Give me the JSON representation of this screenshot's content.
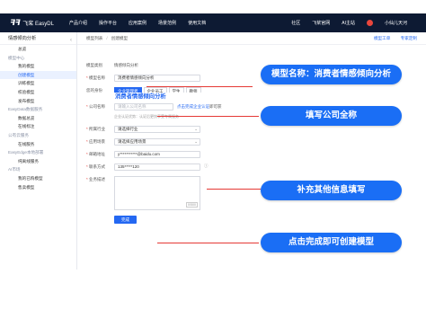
{
  "topnav": {
    "logo_text": "飞桨 EasyDL",
    "left_items": [
      "产品介绍",
      "操作平台",
      "应用案例",
      "场景范例",
      "使用文档"
    ],
    "right_items": [
      "社区",
      "飞桨官网",
      "AI主站"
    ],
    "user_name": "小仙儿天河"
  },
  "sidebar": {
    "title": "情感倾向分析",
    "items": [
      {
        "label": "总览",
        "kind": "item"
      },
      {
        "label": "模型中心",
        "kind": "group"
      },
      {
        "label": "我的模型",
        "kind": "item"
      },
      {
        "label": "创建模型",
        "kind": "item",
        "active": true
      },
      {
        "label": "训练模型",
        "kind": "item"
      },
      {
        "label": "校验模型",
        "kind": "item"
      },
      {
        "label": "发布模型",
        "kind": "item"
      },
      {
        "label": "EasyData数据服务",
        "kind": "group"
      },
      {
        "label": "数据总览",
        "kind": "item"
      },
      {
        "label": "在线标注",
        "kind": "item"
      },
      {
        "label": "公有云服务",
        "kind": "group"
      },
      {
        "label": "在线服务",
        "kind": "item"
      },
      {
        "label": "EasyEdge本地部署",
        "kind": "group"
      },
      {
        "label": "纯离线服务",
        "kind": "item"
      },
      {
        "label": "AI市场",
        "kind": "group"
      },
      {
        "label": "我的已购模型",
        "kind": "item"
      },
      {
        "label": "售卖模型",
        "kind": "item"
      }
    ]
  },
  "breadcrumb": {
    "parent": "模型列表",
    "separator": "/",
    "current": "创建模型",
    "links": [
      "模型工单",
      "专家定制"
    ]
  },
  "form": {
    "model_type_label": "模型类别",
    "model_type_value": "情感倾向分析",
    "model_name_label": "模型名称",
    "model_name_value": "消费者情感倾向分析",
    "identity_label": "您的身份",
    "identity_options": [
      "企业管理者",
      "企业员工",
      "学生",
      "教师"
    ],
    "company_label": "公司名称",
    "company_placeholder": "请输入公司名称",
    "company_hint_link": "点击完成企业认证",
    "company_hint_rest": "即可获",
    "company_note": "企业认证优势：认证后更快享受专属服务",
    "industry_label": "所属行业",
    "industry_placeholder": "请选择行业",
    "scene_label": "应用场景",
    "scene_placeholder": "请选择应用场景",
    "email_label": "邮箱地址",
    "email_value": "y***********@baidu.com",
    "phone_label": "联系方式",
    "phone_value": "135*****120",
    "desc_label": "业务描述",
    "desc_count": "0/500",
    "submit_label": "完成"
  },
  "overlay_model_name": "消费者情感倾向分析",
  "callouts": [
    "模型名称：消费者情感倾向分析",
    "填写公司全称",
    "补充其他信息填写",
    "点击完成即可创建模型"
  ],
  "colors": {
    "nav_bg": "#0d1a33",
    "accent": "#2468f2",
    "callout": "#1a6ef5",
    "redline": "#e53935"
  }
}
